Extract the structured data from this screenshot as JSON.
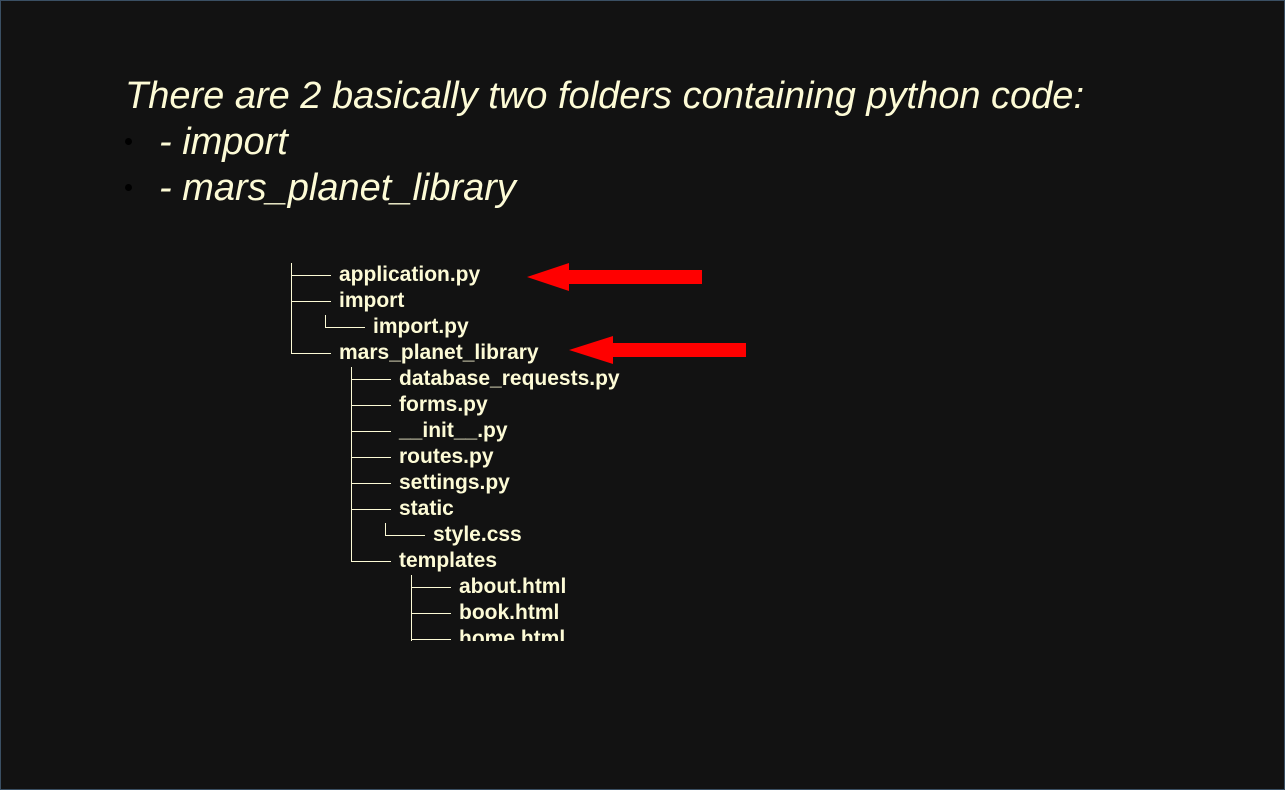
{
  "headline": "There are 2 basically two folders containing python code:",
  "bullets": [
    "- import",
    "- mars_planet_library"
  ],
  "tree": [
    "application.py",
    "import",
    "import.py",
    "mars_planet_library",
    "database_requests.py",
    "forms.py",
    "__init__.py",
    "routes.py",
    "settings.py",
    "static",
    "style.css",
    "templates",
    "about.html",
    "book.html",
    "home.html"
  ],
  "colors": {
    "background": "#121212",
    "text": "#fdfbd6",
    "arrow": "#ff0000"
  },
  "icons": [
    "arrow-left-icon",
    "arrow-left-icon"
  ]
}
